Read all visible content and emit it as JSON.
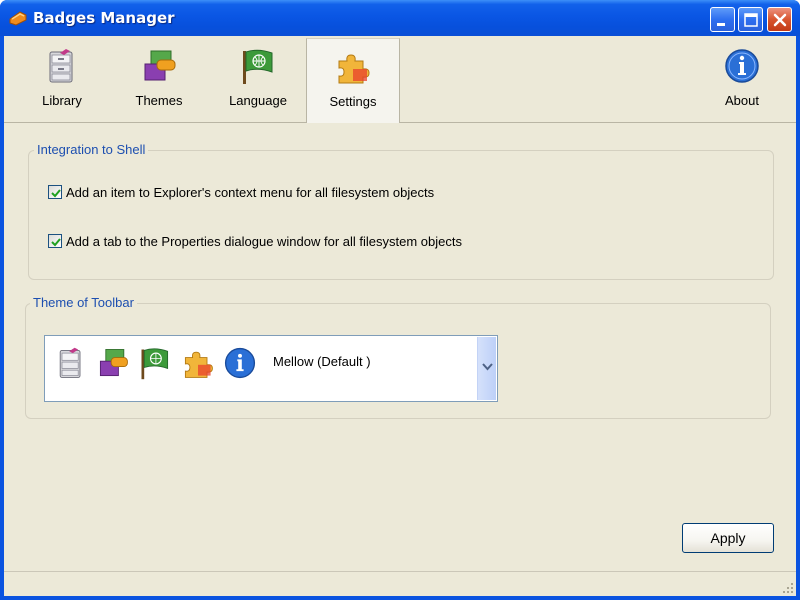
{
  "window": {
    "title": "Badges Manager",
    "app_icon": "badge-app-icon",
    "controls": [
      "minimize",
      "maximize",
      "close"
    ]
  },
  "toolbar": {
    "items": [
      {
        "label": "Library",
        "icon": "library-icon"
      },
      {
        "label": "Themes",
        "icon": "themes-icon"
      },
      {
        "label": "Language",
        "icon": "language-icon"
      },
      {
        "label": "Settings",
        "icon": "settings-icon",
        "active": true
      },
      {
        "label": "About",
        "icon": "about-icon"
      }
    ]
  },
  "integration": {
    "title": "Integration to Shell",
    "options": [
      {
        "label": "Add an item to Explorer's context menu for all filesystem objects",
        "checked": true
      },
      {
        "label": "Add a tab to the Properties dialogue window for all filesystem objects",
        "checked": true
      }
    ]
  },
  "theme": {
    "title": "Theme of Toolbar",
    "selected": "Mellow (Default )",
    "preview_icons": [
      "library-icon",
      "themes-icon",
      "language-icon",
      "settings-icon",
      "about-icon"
    ]
  },
  "buttons": {
    "apply": "Apply"
  },
  "colors": {
    "titlebar": "#0a56e4",
    "window_bg": "#ece9d8",
    "group_title": "#1d4fb0",
    "button_border": "#003c74"
  }
}
